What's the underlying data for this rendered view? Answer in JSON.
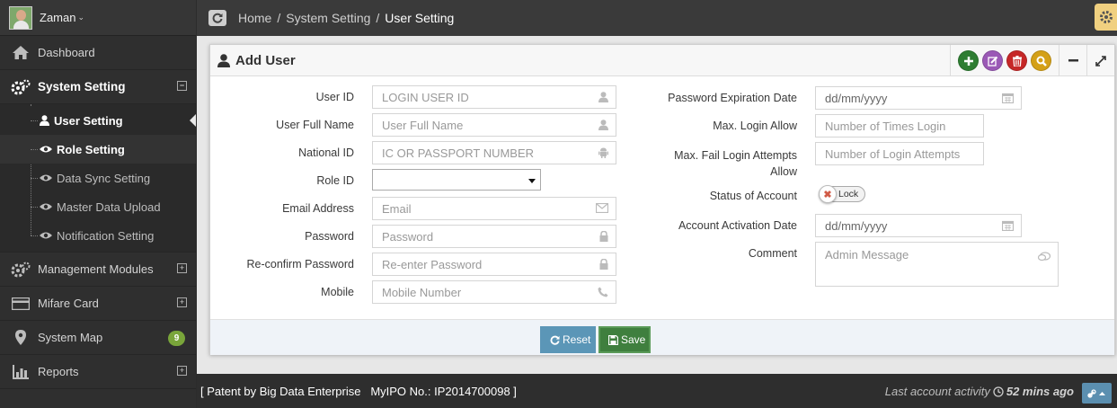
{
  "user": {
    "name": "Zaman"
  },
  "sidebar": {
    "items": [
      {
        "label": "Dashboard",
        "icon": "home-icon"
      },
      {
        "label": "System Setting",
        "icon": "cogs-icon",
        "expanded": true
      },
      {
        "label": "Management Modules",
        "icon": "cogs-icon"
      },
      {
        "label": "Mifare Card",
        "icon": "credit-card-icon"
      },
      {
        "label": "System Map",
        "icon": "map-marker-icon",
        "badge": "9"
      },
      {
        "label": "Reports",
        "icon": "bar-chart-icon"
      }
    ],
    "submenu": [
      {
        "label": "User Setting",
        "icon": "user-icon",
        "current": true
      },
      {
        "label": "Role Setting",
        "icon": "eye-icon"
      },
      {
        "label": "Data Sync Setting",
        "icon": "eye-icon"
      },
      {
        "label": "Master Data Upload",
        "icon": "eye-icon"
      },
      {
        "label": "Notification Setting",
        "icon": "eye-icon"
      }
    ]
  },
  "breadcrumb": {
    "home": "Home",
    "parent": "System Setting",
    "current": "User Setting",
    "separator": "/"
  },
  "form": {
    "title": "Add User",
    "left": [
      {
        "label": "User ID",
        "placeholder": "LOGIN USER ID",
        "icon": "user-icon"
      },
      {
        "label": "User Full Name",
        "placeholder": "User Full Name",
        "icon": "user-icon"
      },
      {
        "label": "National ID",
        "placeholder": "IC OR PASSPORT NUMBER",
        "icon": "android-icon"
      },
      {
        "label": "Role ID",
        "value": "",
        "icon": "caret-down-icon"
      },
      {
        "label": "Email Address",
        "placeholder": "Email",
        "icon": "envelope-icon"
      },
      {
        "label": "Password",
        "placeholder": "Password",
        "icon": "lock-icon"
      },
      {
        "label": "Re-confirm Password",
        "placeholder": "Re-enter Password",
        "icon": "lock-icon"
      },
      {
        "label": "Mobile",
        "placeholder": "Mobile Number",
        "icon": "phone-icon"
      }
    ],
    "right": {
      "pwd_exp_label": "Password Expiration Date",
      "pwd_exp_placeholder": "dd/mm/yyyy",
      "max_login_label": "Max. Login Allow",
      "max_login_placeholder": "Number of Times Login",
      "max_fail_label_1": "Max. Fail Login Attempts",
      "max_fail_label_2": "Allow",
      "max_fail_placeholder": "Number of Login Attempts",
      "status_label": "Status of Account",
      "status_toggle": "Lock",
      "activation_label": "Account Activation Date",
      "activation_placeholder": "dd/mm/yyyy",
      "comment_label": "Comment",
      "comment_placeholder": "Admin Message"
    },
    "buttons": {
      "reset": "Reset",
      "save": "Save"
    }
  },
  "footer": {
    "patent": "[ Patent by Big Data Enterprise   MyIPO No.: IP2014700098 ]",
    "activity_label": "Last account activity",
    "activity_value": "52 mins ago"
  },
  "colors": {
    "sidebar_bg": "#2f2f2f",
    "add_btn": "#2e7d32",
    "edit_btn": "#9b59b6",
    "delete_btn": "#c62828",
    "search_btn": "#d4a017",
    "reset_btn": "#5b96b7",
    "save_btn": "#3f7f3e",
    "badge": "#79a53a"
  }
}
